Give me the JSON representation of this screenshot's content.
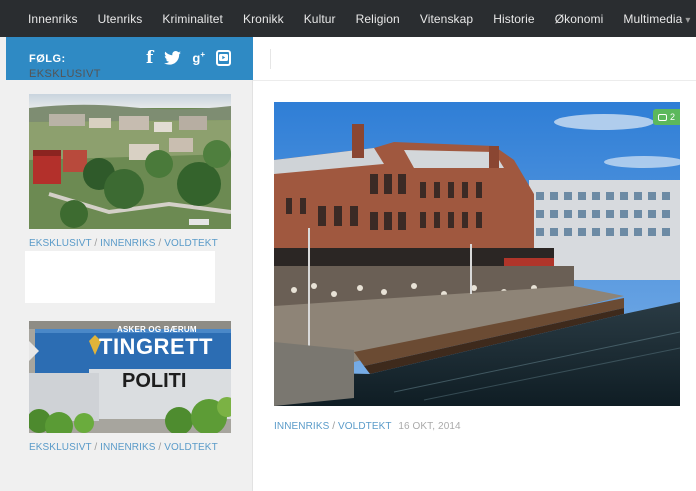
{
  "nav": {
    "items": [
      {
        "label": "Innenriks"
      },
      {
        "label": "Utenriks"
      },
      {
        "label": "Kriminalitet"
      },
      {
        "label": "Kronikk"
      },
      {
        "label": "Kultur"
      },
      {
        "label": "Religion"
      },
      {
        "label": "Vitenskap"
      },
      {
        "label": "Historie"
      },
      {
        "label": "Økonomi"
      },
      {
        "label": "Multimedia",
        "has_dropdown": true
      }
    ]
  },
  "sidebar": {
    "follow_label": "FØLG:",
    "social_icons": [
      "facebook-icon",
      "twitter-icon",
      "google-plus-icon",
      "youtube-icon"
    ],
    "section_title": "EKSKLUSIVT",
    "articles": [
      {
        "image": "town-aerial-view",
        "categories": [
          "EKSKLUSIVT",
          "INNENRIKS",
          "VOLDTEKT"
        ]
      },
      {
        "image": "tingrett-politi-sign",
        "sign_line1": "ASKER OG BÆRUM",
        "sign_line2": "TINGRETT",
        "sign_line3": "POLITI",
        "categories": [
          "EKSKLUSIVT",
          "INNENRIKS",
          "VOLDTEKT"
        ]
      }
    ]
  },
  "main": {
    "feature": {
      "image": "brick-building-waterfront",
      "comment_count": "2",
      "categories": [
        "INNENRIKS",
        "VOLDTEKT"
      ],
      "date": "16 OKT, 2014"
    }
  },
  "colors": {
    "nav_bg": "#2a2d30",
    "follow_bg": "#2f8ac4",
    "link_blue": "#5a9bc9",
    "badge_green": "#5cb85c"
  }
}
